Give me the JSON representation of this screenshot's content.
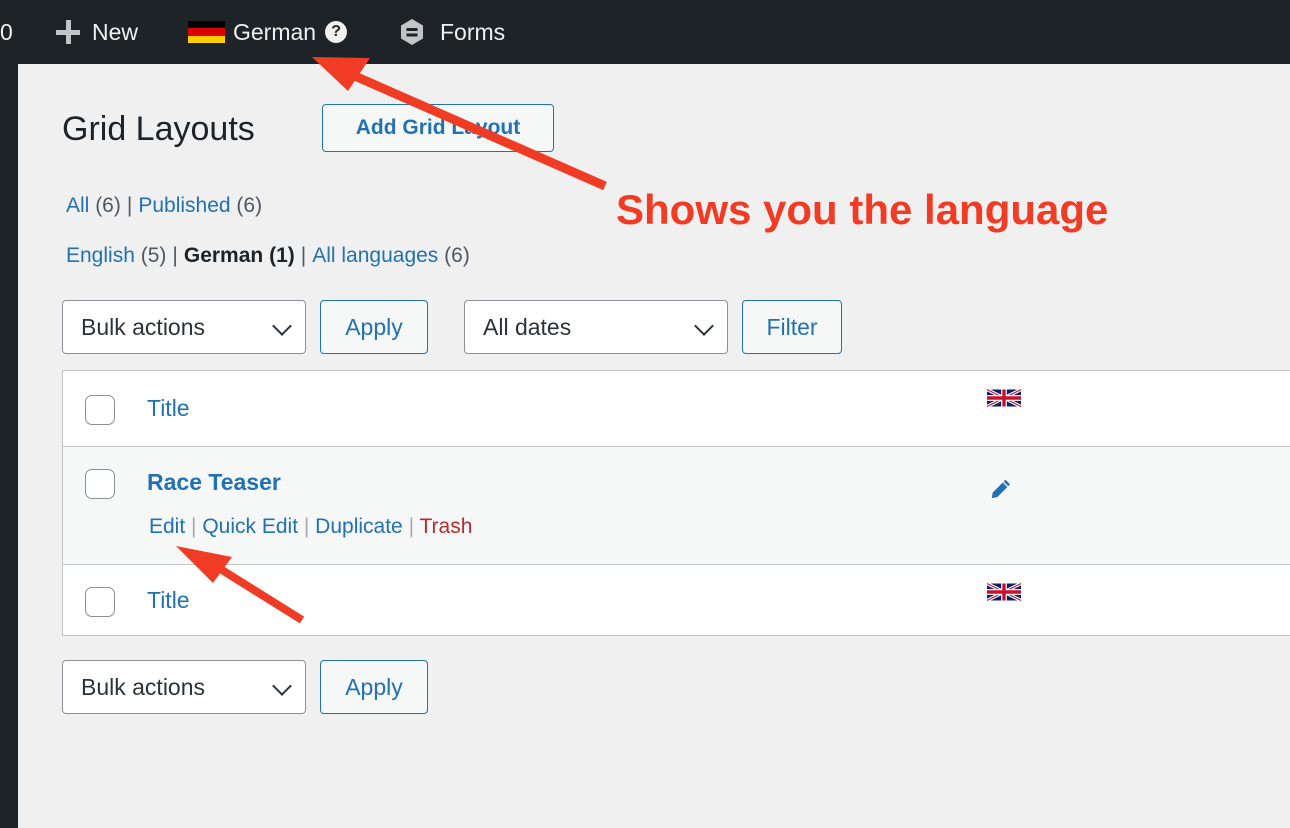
{
  "admin_bar": {
    "counter": "0",
    "new_label": "New",
    "language_label": "German",
    "help_glyph": "?",
    "forms_label": "Forms",
    "icons": [
      "plus-icon",
      "german-flag-icon",
      "help-icon",
      "forms-icon"
    ]
  },
  "page": {
    "title": "Grid Layouts",
    "add_button": "Add Grid Layout"
  },
  "status_filters": {
    "all_label": "All",
    "all_count": "(6)",
    "published_label": "Published",
    "published_count": "(6)"
  },
  "language_filters": {
    "english_label": "English",
    "english_count": "(5)",
    "german_label": "German (1)",
    "all_languages_label": "All languages",
    "all_languages_count": "(6)"
  },
  "toolbar_top": {
    "bulk_actions": "Bulk actions",
    "apply": "Apply",
    "dates": "All dates",
    "filter": "Filter"
  },
  "table": {
    "header_title": "Title",
    "rows": [
      {
        "title": "Race Teaser",
        "actions": {
          "edit": "Edit",
          "quick_edit": "Quick Edit",
          "duplicate": "Duplicate",
          "trash": "Trash"
        },
        "language_icon": "pencil-icon"
      }
    ],
    "footer_title": "Title",
    "language_icon": "uk-flag-icon"
  },
  "toolbar_bottom": {
    "bulk_actions": "Bulk actions",
    "apply": "Apply"
  },
  "annotation": {
    "text": "Shows you the language",
    "color": "#f03c24"
  },
  "colors": {
    "admin_bar": "#1d2327",
    "link": "#2271b1",
    "trash": "#b32d2e",
    "background": "#f0f0f1"
  }
}
